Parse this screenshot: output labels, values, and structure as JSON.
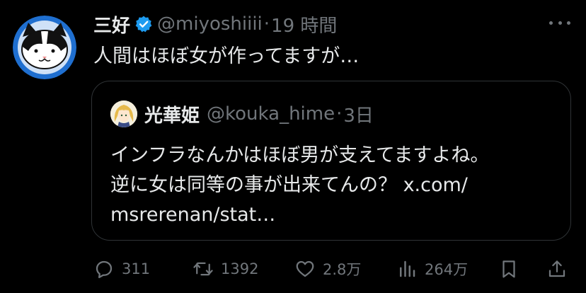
{
  "tweet": {
    "author_name": "三好",
    "author_handle": "@miyoshiiii",
    "separator": "·",
    "time_ago": "19 時間",
    "text": "人間はほぼ女が作ってますが…",
    "avatar_icon": "cat-avatar",
    "verified_icon": "verified-badge-icon",
    "verified_color": "#1d9bf0"
  },
  "quote": {
    "author_name": "光華姫",
    "author_handle": "@kouka_hime",
    "separator": "·",
    "time_ago": "3日",
    "text_lines": [
      "インフラなんかはほぼ男が支えてますよね。",
      "逆に女は同等の事が出来てんの？ x.com/",
      "msrerenan/stat…"
    ],
    "avatar_icon": "anime-girl-avatar"
  },
  "actions": {
    "reply_count": "311",
    "retweet_count": "1392",
    "like_count": "2.8万",
    "views_count": "264万",
    "icons": [
      "reply-icon",
      "retweet-icon",
      "like-icon",
      "views-icon",
      "bookmark-icon",
      "share-icon"
    ]
  },
  "colors": {
    "background": "#000000",
    "text_primary": "#e7e9ea",
    "text_secondary": "#71767b",
    "border": "#2f3336",
    "avatar_bg": "#1f6fd0"
  }
}
